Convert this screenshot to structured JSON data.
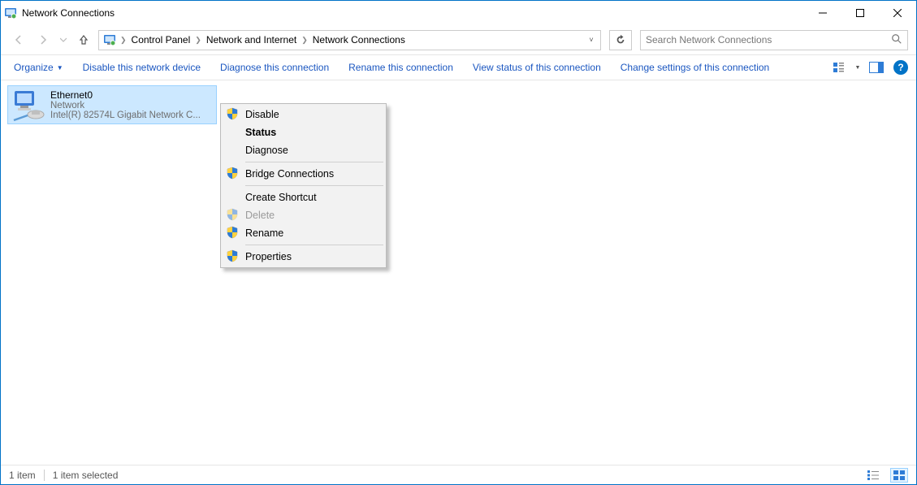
{
  "window": {
    "title": "Network Connections"
  },
  "breadcrumb": {
    "root": "Control Panel",
    "mid": "Network and Internet",
    "leaf": "Network Connections"
  },
  "search": {
    "placeholder": "Search Network Connections"
  },
  "commandbar": {
    "organize": "Organize",
    "disable_device": "Disable this network device",
    "diagnose": "Diagnose this connection",
    "rename": "Rename this connection",
    "view_status": "View status of this connection",
    "change_settings": "Change settings of this connection"
  },
  "adapter": {
    "name": "Ethernet0",
    "status": "Network",
    "device": "Intel(R) 82574L Gigabit Network C..."
  },
  "context_menu": {
    "disable": "Disable",
    "status": "Status",
    "diagnose": "Diagnose",
    "bridge": "Bridge Connections",
    "create_shortcut": "Create Shortcut",
    "delete": "Delete",
    "rename": "Rename",
    "properties": "Properties"
  },
  "statusbar": {
    "count": "1 item",
    "selected": "1 item selected"
  }
}
